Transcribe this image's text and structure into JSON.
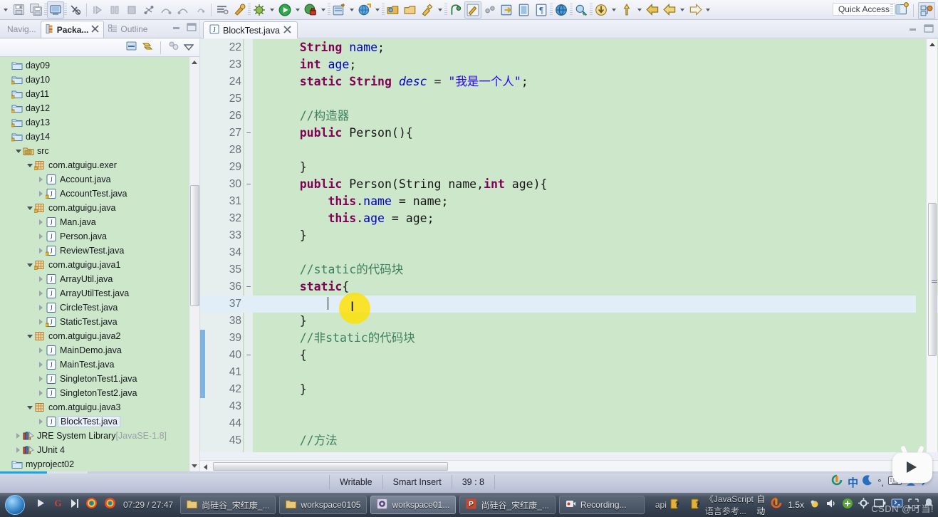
{
  "app": {
    "quick_access": "Quick Access"
  },
  "toolbar": {
    "icons": [
      "dropdown-caret-icon",
      "save-icon",
      "save-all-icon",
      "print-icon",
      "no-link-icon",
      "run-step-icon",
      "pause-icon",
      "stop-icon",
      "step-into-icon",
      "step-over-icon",
      "step-return-icon",
      "drop-to-frame-icon",
      "skip-breakpoints-icon",
      "last-launch-icon",
      "external-tools-icon",
      "debug-icon",
      "run-icon",
      "coverage-icon",
      "new-java-project-icon",
      "new-package-icon",
      "open-type-icon",
      "open-task-icon",
      "search-icon",
      "toggle-mark-occurrences-icon",
      "link-icon",
      "next-annotation-icon",
      "previous-annotation-icon",
      "toggle-whitespace-icon",
      "web-browser-icon",
      "search-reference-icon",
      "download-icon",
      "pin-editor-icon",
      "back-icon",
      "forward-icon"
    ],
    "quick_access_right_icons": [
      "open-perspective-icon",
      "java-perspective-icon"
    ]
  },
  "left_panel": {
    "tabs": [
      {
        "label": "Navig...",
        "icon": "navigator-icon",
        "active": false,
        "closable": false
      },
      {
        "label": "Packa...",
        "icon": "package-explorer-icon",
        "active": true,
        "closable": true
      },
      {
        "label": "Outline",
        "icon": "outline-icon",
        "active": false,
        "closable": false
      }
    ],
    "window_controls": [
      "minimize-icon",
      "maximize-icon"
    ],
    "view_toolbar": [
      "collapse-all-icon",
      "link-with-editor-icon",
      "focus-icon",
      "view-menu-icon"
    ],
    "tree": [
      {
        "indent": 0,
        "twisty": "none",
        "icon": "project-folder-icon",
        "label": "day09",
        "dim": "",
        "selected": false
      },
      {
        "indent": 0,
        "twisty": "none",
        "icon": "project-folder-warn-icon",
        "label": "day10",
        "dim": "",
        "selected": false
      },
      {
        "indent": 0,
        "twisty": "none",
        "icon": "project-folder-warn-icon",
        "label": "day11",
        "dim": "",
        "selected": false
      },
      {
        "indent": 0,
        "twisty": "none",
        "icon": "project-folder-warn-icon",
        "label": "day12",
        "dim": "",
        "selected": false
      },
      {
        "indent": 0,
        "twisty": "none",
        "icon": "project-folder-warn-icon",
        "label": "day13",
        "dim": "",
        "selected": false
      },
      {
        "indent": 0,
        "twisty": "none",
        "icon": "project-folder-warn-icon",
        "label": "day14",
        "dim": "",
        "selected": false
      },
      {
        "indent": 1,
        "twisty": "open",
        "icon": "source-folder-icon",
        "label": "src",
        "dim": "",
        "selected": false
      },
      {
        "indent": 2,
        "twisty": "open",
        "icon": "package-warn-icon",
        "label": "com.atguigu.exer",
        "dim": "",
        "selected": false
      },
      {
        "indent": 3,
        "twisty": "closed",
        "icon": "java-file-icon",
        "label": "Account.java",
        "dim": "",
        "selected": false
      },
      {
        "indent": 3,
        "twisty": "closed",
        "icon": "java-file-warn-icon",
        "label": "AccountTest.java",
        "dim": "",
        "selected": false
      },
      {
        "indent": 2,
        "twisty": "open",
        "icon": "package-warn-icon",
        "label": "com.atguigu.java",
        "dim": "",
        "selected": false
      },
      {
        "indent": 3,
        "twisty": "closed",
        "icon": "java-file-icon",
        "label": "Man.java",
        "dim": "",
        "selected": false
      },
      {
        "indent": 3,
        "twisty": "closed",
        "icon": "java-file-icon",
        "label": "Person.java",
        "dim": "",
        "selected": false
      },
      {
        "indent": 3,
        "twisty": "closed",
        "icon": "java-file-warn-icon",
        "label": "ReviewTest.java",
        "dim": "",
        "selected": false
      },
      {
        "indent": 2,
        "twisty": "open",
        "icon": "package-warn-icon",
        "label": "com.atguigu.java1",
        "dim": "",
        "selected": false
      },
      {
        "indent": 3,
        "twisty": "closed",
        "icon": "java-file-icon",
        "label": "ArrayUtil.java",
        "dim": "",
        "selected": false
      },
      {
        "indent": 3,
        "twisty": "closed",
        "icon": "java-file-icon",
        "label": "ArrayUtilTest.java",
        "dim": "",
        "selected": false
      },
      {
        "indent": 3,
        "twisty": "closed",
        "icon": "java-file-icon",
        "label": "CircleTest.java",
        "dim": "",
        "selected": false
      },
      {
        "indent": 3,
        "twisty": "closed",
        "icon": "java-file-warn-icon",
        "label": "StaticTest.java",
        "dim": "",
        "selected": false
      },
      {
        "indent": 2,
        "twisty": "open",
        "icon": "package-icon",
        "label": "com.atguigu.java2",
        "dim": "",
        "selected": false
      },
      {
        "indent": 3,
        "twisty": "closed",
        "icon": "java-file-icon",
        "label": "MainDemo.java",
        "dim": "",
        "selected": false
      },
      {
        "indent": 3,
        "twisty": "closed",
        "icon": "java-file-icon",
        "label": "MainTest.java",
        "dim": "",
        "selected": false
      },
      {
        "indent": 3,
        "twisty": "closed",
        "icon": "java-file-icon",
        "label": "SingletonTest1.java",
        "dim": "",
        "selected": false
      },
      {
        "indent": 3,
        "twisty": "closed",
        "icon": "java-file-icon",
        "label": "SingletonTest2.java",
        "dim": "",
        "selected": false
      },
      {
        "indent": 2,
        "twisty": "open",
        "icon": "package-icon",
        "label": "com.atguigu.java3",
        "dim": "",
        "selected": false
      },
      {
        "indent": 3,
        "twisty": "closed",
        "icon": "java-file-icon",
        "label": "BlockTest.java",
        "dim": "",
        "selected": true
      },
      {
        "indent": 1,
        "twisty": "closed",
        "icon": "library-icon",
        "label": "JRE System Library",
        "dim": "[JavaSE-1.8]",
        "selected": false
      },
      {
        "indent": 1,
        "twisty": "closed",
        "icon": "library-icon",
        "label": "JUnit 4",
        "dim": "",
        "selected": false
      },
      {
        "indent": 0,
        "twisty": "none",
        "icon": "project-folder-icon",
        "label": "myproject02",
        "dim": "",
        "selected": false
      }
    ]
  },
  "editor": {
    "tab": {
      "label": "BlockTest.java",
      "icon": "java-file-icon",
      "close": "close-icon"
    },
    "window_controls": [
      "minimize-icon",
      "maximize-icon"
    ],
    "first_line": 22,
    "lines": [
      {
        "n": 22,
        "fold": "",
        "indent": 1,
        "tokens": [
          {
            "t": "kw",
            "v": "String"
          },
          {
            "t": "pln",
            "v": " "
          },
          {
            "t": "fld",
            "v": "name"
          },
          {
            "t": "pln",
            "v": ";"
          }
        ]
      },
      {
        "n": 23,
        "fold": "",
        "indent": 1,
        "tokens": [
          {
            "t": "kw",
            "v": "int"
          },
          {
            "t": "pln",
            "v": " "
          },
          {
            "t": "fld",
            "v": "age"
          },
          {
            "t": "pln",
            "v": ";"
          }
        ]
      },
      {
        "n": 24,
        "fold": "",
        "indent": 1,
        "tokens": [
          {
            "t": "kw",
            "v": "static"
          },
          {
            "t": "pln",
            "v": " "
          },
          {
            "t": "kw",
            "v": "String"
          },
          {
            "t": "pln",
            "v": " "
          },
          {
            "t": "fldi",
            "v": "desc"
          },
          {
            "t": "pln",
            "v": " = "
          },
          {
            "t": "str",
            "v": "\"我是一个人\""
          },
          {
            "t": "pln",
            "v": ";"
          }
        ]
      },
      {
        "n": 25,
        "fold": "",
        "indent": 0,
        "tokens": []
      },
      {
        "n": 26,
        "fold": "",
        "indent": 1,
        "tokens": [
          {
            "t": "cmt",
            "v": "//构造器"
          }
        ]
      },
      {
        "n": 27,
        "fold": "−",
        "indent": 1,
        "tokens": [
          {
            "t": "kw",
            "v": "public"
          },
          {
            "t": "pln",
            "v": " Person(){"
          }
        ]
      },
      {
        "n": 28,
        "fold": "",
        "indent": 0,
        "tokens": []
      },
      {
        "n": 29,
        "fold": "",
        "indent": 1,
        "tokens": [
          {
            "t": "pln",
            "v": "}"
          }
        ]
      },
      {
        "n": 30,
        "fold": "−",
        "indent": 1,
        "tokens": [
          {
            "t": "kw",
            "v": "public"
          },
          {
            "t": "pln",
            "v": " Person(String name,"
          },
          {
            "t": "kw",
            "v": "int"
          },
          {
            "t": "pln",
            "v": " age){"
          }
        ]
      },
      {
        "n": 31,
        "fold": "",
        "indent": 2,
        "tokens": [
          {
            "t": "kw",
            "v": "this"
          },
          {
            "t": "pln",
            "v": "."
          },
          {
            "t": "fld",
            "v": "name"
          },
          {
            "t": "pln",
            "v": " = name;"
          }
        ]
      },
      {
        "n": 32,
        "fold": "",
        "indent": 2,
        "tokens": [
          {
            "t": "kw",
            "v": "this"
          },
          {
            "t": "pln",
            "v": "."
          },
          {
            "t": "fld",
            "v": "age"
          },
          {
            "t": "pln",
            "v": " = age;"
          }
        ]
      },
      {
        "n": 33,
        "fold": "",
        "indent": 1,
        "tokens": [
          {
            "t": "pln",
            "v": "}"
          }
        ]
      },
      {
        "n": 34,
        "fold": "",
        "indent": 0,
        "tokens": []
      },
      {
        "n": 35,
        "fold": "",
        "indent": 1,
        "tokens": [
          {
            "t": "cmt",
            "v": "//static的代码块"
          }
        ]
      },
      {
        "n": 36,
        "fold": "−",
        "indent": 1,
        "tokens": [
          {
            "t": "kw",
            "v": "static"
          },
          {
            "t": "pln",
            "v": "{"
          }
        ]
      },
      {
        "n": 37,
        "fold": "",
        "indent": 2,
        "tokens": [],
        "caret": true,
        "highlight": true
      },
      {
        "n": 38,
        "fold": "",
        "indent": 1,
        "tokens": [
          {
            "t": "pln",
            "v": "}"
          }
        ]
      },
      {
        "n": 39,
        "fold": "",
        "indent": 1,
        "tokens": [
          {
            "t": "cmt",
            "v": "//非static的代码块"
          }
        ],
        "changed": true
      },
      {
        "n": 40,
        "fold": "−",
        "indent": 1,
        "tokens": [
          {
            "t": "pln",
            "v": "{"
          }
        ],
        "changed": true
      },
      {
        "n": 41,
        "fold": "",
        "indent": 0,
        "tokens": [],
        "changed": true
      },
      {
        "n": 42,
        "fold": "",
        "indent": 1,
        "tokens": [
          {
            "t": "pln",
            "v": "}"
          }
        ],
        "changed": true
      },
      {
        "n": 43,
        "fold": "",
        "indent": 0,
        "tokens": []
      },
      {
        "n": 44,
        "fold": "",
        "indent": 0,
        "tokens": []
      },
      {
        "n": 45,
        "fold": "",
        "indent": 1,
        "tokens": [
          {
            "t": "cmt",
            "v": "//方法"
          }
        ]
      }
    ]
  },
  "statusbar": {
    "writable": "Writable",
    "insert_mode": "Smart Insert",
    "position": "39 : 8",
    "tray_icons": [
      "sogou-ime-icon",
      "chinese-mode-icon",
      "moon-icon",
      "halfwidth-icon",
      "keyboard-icon",
      "user-icon",
      "tools-icon"
    ]
  },
  "taskbar": {
    "media_controls": [
      "play-icon",
      "gif-icon",
      "next-icon",
      "chrome-icon",
      "chrome2-icon"
    ],
    "time": "07:29 / 27:47",
    "items": [
      {
        "label": "尚硅谷_宋红康_...",
        "icon": "folder-icon",
        "active": false
      },
      {
        "label": "workspace0105",
        "icon": "folder-icon",
        "active": false
      },
      {
        "label": "workspace01...",
        "icon": "eclipse-icon",
        "active": true
      },
      {
        "label": "尚硅谷_宋红康_...",
        "icon": "powerpoint-icon",
        "active": false
      },
      {
        "label": "Recording...",
        "icon": "recorder-icon",
        "active": false
      }
    ],
    "extra_items": [
      {
        "label": "api",
        "icon": "help-icon"
      },
      {
        "label": "《JavaScript 语言参考...",
        "icon": "chm-icon"
      }
    ],
    "tray_text_1": "自动",
    "tray_speed": "1.5x",
    "tray_icons": [
      "sogou-icon",
      "brightness-icon",
      "volume-icon",
      "add-icon",
      "gear-icon",
      "battery-icon",
      "network-icon",
      "expand-icon",
      "notify-icon"
    ],
    "watermark": "CSDN @叮当!"
  },
  "float_widget": {
    "icon": "video-play-icon"
  },
  "colors": {
    "editor_bg": "#cde7cb",
    "gutter_bg": "#e7eeee",
    "highlight_line": "#e1edf7",
    "keyword": "#7f0055",
    "field": "#0000c0",
    "string": "#2a00ff",
    "comment": "#3f7f5f",
    "changebar": "#7fb3e0",
    "cursor_highlight": "#ffe100",
    "progress": "#19a3e8"
  }
}
